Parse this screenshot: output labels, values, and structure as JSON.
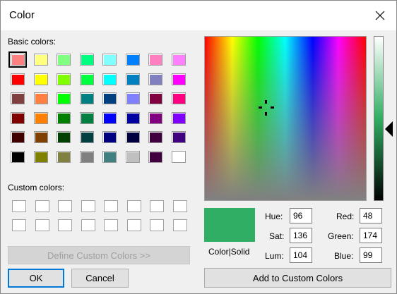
{
  "window": {
    "title": "Color"
  },
  "labels": {
    "basic_colors": "Basic colors:",
    "custom_colors": "Custom colors:",
    "color_solid": "Color|Solid",
    "hue": "Hue:",
    "sat": "Sat:",
    "lum": "Lum:",
    "red": "Red:",
    "green": "Green:",
    "blue": "Blue:"
  },
  "values": {
    "hue": "96",
    "sat": "136",
    "lum": "104",
    "red": "48",
    "green": "174",
    "blue": "99"
  },
  "buttons": {
    "define_custom": "Define Custom Colors >>",
    "ok": "OK",
    "cancel": "Cancel",
    "add_custom": "Add to Custom Colors"
  },
  "current_color": "#30ae63",
  "selected_swatch": 0,
  "basic_colors": [
    "#ff8080",
    "#ffff80",
    "#80ff80",
    "#00ff80",
    "#80ffff",
    "#0080ff",
    "#ff80c0",
    "#ff80ff",
    "#ff0000",
    "#ffff00",
    "#80ff00",
    "#00ff40",
    "#00ffff",
    "#0080c0",
    "#8080c0",
    "#ff00ff",
    "#804040",
    "#ff8040",
    "#00ff00",
    "#008080",
    "#004080",
    "#8080ff",
    "#800040",
    "#ff0080",
    "#800000",
    "#ff8000",
    "#008000",
    "#008040",
    "#0000ff",
    "#0000a0",
    "#800080",
    "#8000ff",
    "#400000",
    "#804000",
    "#004000",
    "#004040",
    "#000080",
    "#000040",
    "#400040",
    "#400080",
    "#000000",
    "#808000",
    "#808040",
    "#808080",
    "#408080",
    "#c0c0c0",
    "#400040",
    "#ffffff"
  ],
  "custom_colors": [
    "#ffffff",
    "#ffffff",
    "#ffffff",
    "#ffffff",
    "#ffffff",
    "#ffffff",
    "#ffffff",
    "#ffffff",
    "#ffffff",
    "#ffffff",
    "#ffffff",
    "#ffffff",
    "#ffffff",
    "#ffffff",
    "#ffffff",
    "#ffffff"
  ],
  "icons": {
    "close": "close-icon",
    "crosshair": "crosshair-icon",
    "lum_pointer": "triangle-left-icon"
  }
}
